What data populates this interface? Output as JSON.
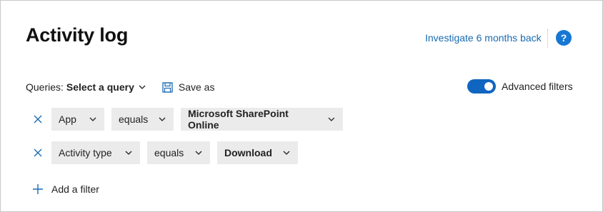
{
  "header": {
    "title": "Activity log",
    "investigate_link": "Investigate 6 months back",
    "help_glyph": "?"
  },
  "queries": {
    "label": "Queries:",
    "selected": "Select a query",
    "save_label": "Save as"
  },
  "advanced_filters": {
    "label": "Advanced filters",
    "enabled": true
  },
  "filters": [
    {
      "field": "App",
      "operator": "equals",
      "value": "Microsoft SharePoint Online"
    },
    {
      "field": "Activity type",
      "operator": "equals",
      "value": "Download"
    }
  ],
  "add_filter_label": "Add a filter",
  "colors": {
    "accent": "#1065c0",
    "link": "#1a6bb3",
    "help_bg": "#1777d4",
    "dropdown_bg": "#ebebeb",
    "remove_icon": "#1a6bb3"
  },
  "icons": {
    "help": "question-circle-icon",
    "save": "floppy-disk-icon",
    "remove": "close-icon",
    "dropdown": "chevron-down-icon",
    "add": "plus-icon"
  }
}
